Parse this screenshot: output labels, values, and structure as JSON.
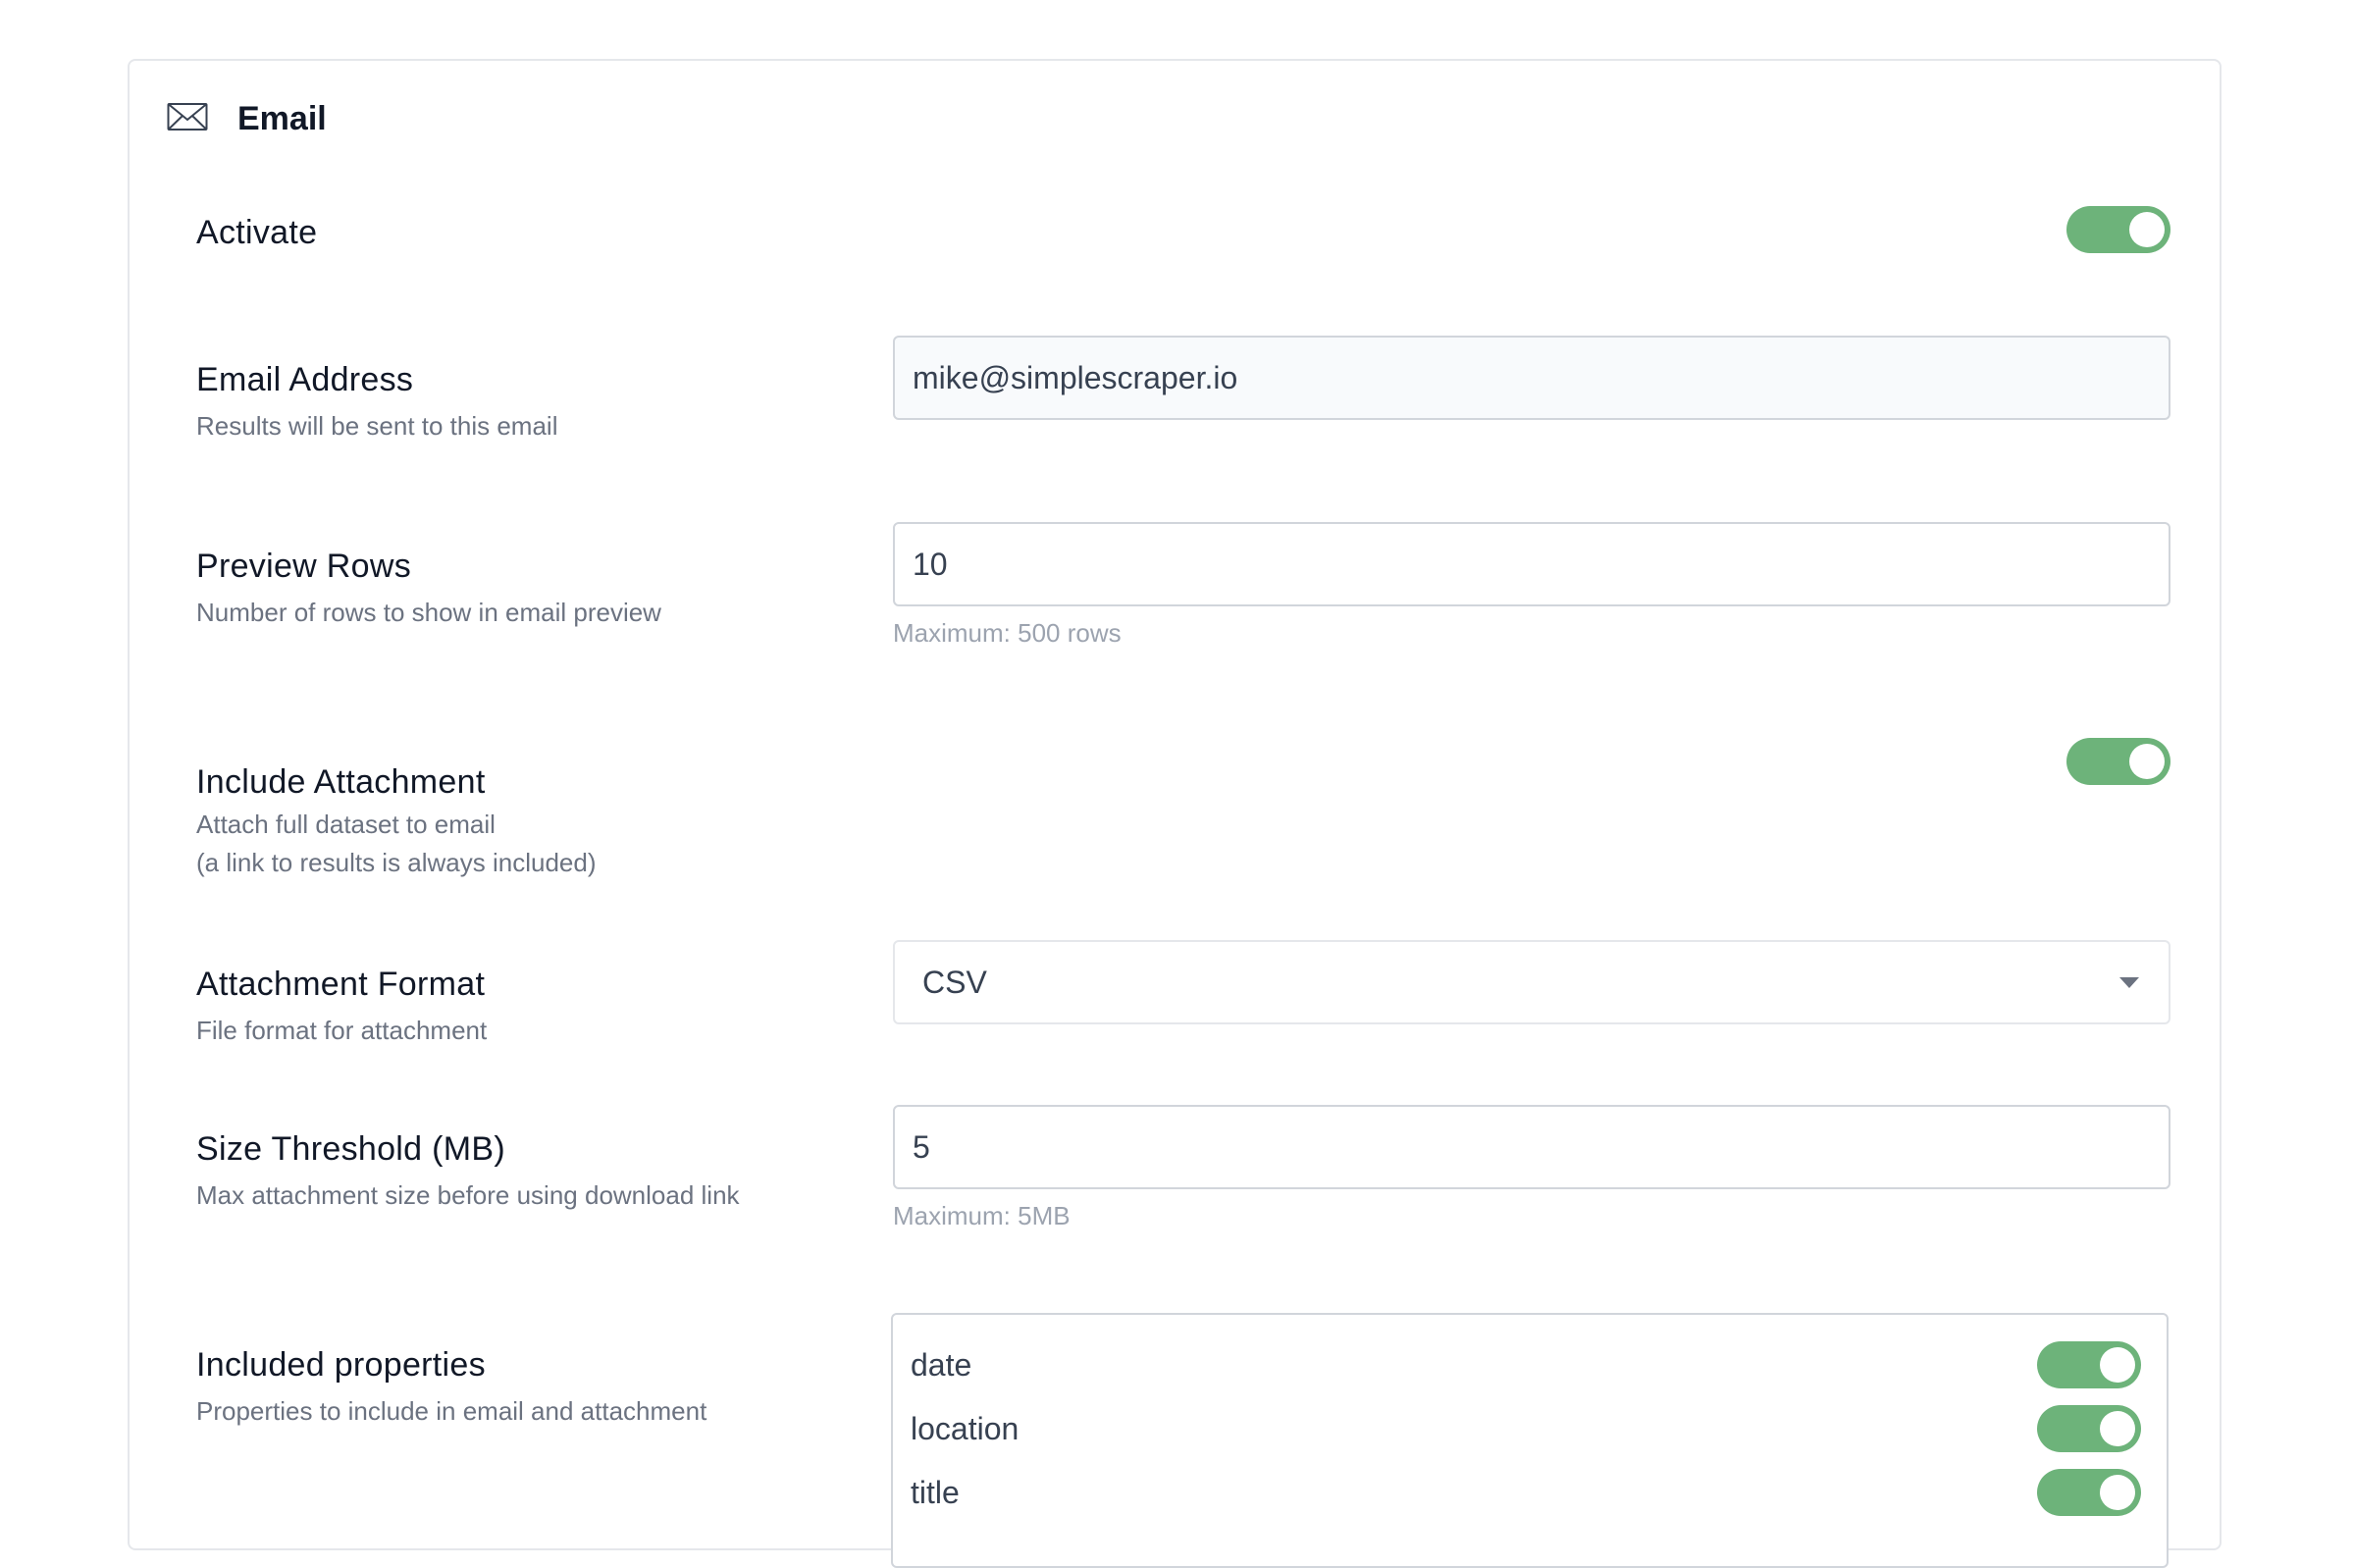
{
  "section": {
    "title": "Email",
    "icon": "envelope-icon"
  },
  "activate": {
    "label": "Activate",
    "enabled": true
  },
  "email_address": {
    "label": "Email Address",
    "description": "Results will be sent to this email",
    "value": "mike@simplescraper.io"
  },
  "preview_rows": {
    "label": "Preview Rows",
    "description": "Number of rows to show in email preview",
    "value": "10",
    "hint": "Maximum: 500 rows"
  },
  "include_attachment": {
    "label": "Include Attachment",
    "description_line1": "Attach full dataset to email",
    "description_line2": "(a link to results is always included)",
    "enabled": true
  },
  "attachment_format": {
    "label": "Attachment Format",
    "description": "File format for attachment",
    "selected": "CSV"
  },
  "size_threshold": {
    "label": "Size Threshold (MB)",
    "description": "Max attachment size before using download link",
    "value": "5",
    "hint": "Maximum: 5MB"
  },
  "included_properties": {
    "label": "Included properties",
    "description": "Properties to include in email and attachment",
    "items": [
      {
        "name": "date",
        "enabled": true
      },
      {
        "name": "location",
        "enabled": true
      },
      {
        "name": "title",
        "enabled": true
      }
    ]
  },
  "colors": {
    "toggle_on": "#6db37a",
    "border": "#d1d5db"
  }
}
